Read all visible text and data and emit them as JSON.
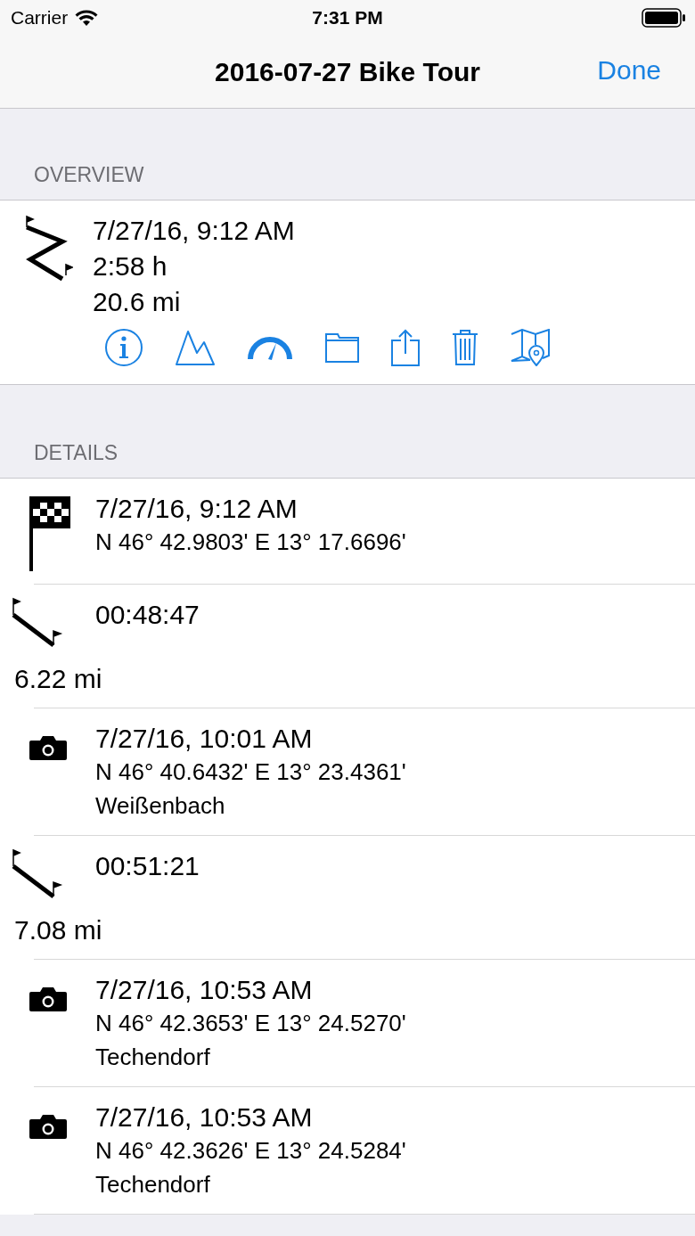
{
  "status_bar": {
    "carrier": "Carrier",
    "time": "7:31 PM"
  },
  "nav": {
    "title": "2016-07-27 Bike Tour",
    "done": "Done"
  },
  "overview": {
    "header": "OVERVIEW",
    "lines": [
      "7/27/16, 9:12 AM",
      "2:58 h",
      "20.6 mi"
    ],
    "actions": [
      {
        "kind": "info"
      },
      {
        "kind": "elevation"
      },
      {
        "kind": "speed"
      },
      {
        "kind": "folder"
      },
      {
        "kind": "share"
      },
      {
        "kind": "trash"
      },
      {
        "kind": "map"
      }
    ]
  },
  "details": {
    "header": "DETAILS",
    "rows": [
      {
        "kind": "start",
        "title": "7/27/16, 9:12 AM",
        "lines": [
          "N 46° 42.9803' E 13° 17.6696'"
        ]
      },
      {
        "kind": "segment",
        "title": "00:48:47",
        "distance": "6.22 mi"
      },
      {
        "kind": "photo",
        "title": "7/27/16, 10:01 AM",
        "lines": [
          "N 46° 40.6432' E 13° 23.4361'",
          "Weißenbach"
        ]
      },
      {
        "kind": "segment",
        "title": "00:51:21",
        "distance": "7.08 mi"
      },
      {
        "kind": "photo",
        "title": "7/27/16, 10:53 AM",
        "lines": [
          "N 46° 42.3653' E 13° 24.5270'",
          "Techendorf"
        ]
      },
      {
        "kind": "photo",
        "title": "7/27/16, 10:53 AM",
        "lines": [
          "N 46° 42.3626' E 13° 24.5284'",
          "Techendorf"
        ]
      }
    ]
  }
}
